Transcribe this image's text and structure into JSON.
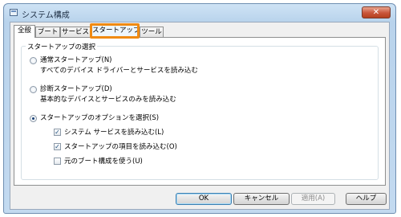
{
  "window": {
    "title": "システム構成",
    "close_label": "✕"
  },
  "tabs": [
    {
      "label": "全般"
    },
    {
      "label": "ブート"
    },
    {
      "label": "サービス"
    },
    {
      "label": "スタートアップ"
    },
    {
      "label": "ツール"
    }
  ],
  "startup_selection": {
    "legend": "スタートアップの選択",
    "normal": {
      "label": "通常スタートアップ(N)",
      "description": "すべてのデバイス ドライバーとサービスを読み込む"
    },
    "diagnostic": {
      "label": "診断スタートアップ(D)",
      "description": "基本的なデバイスとサービスのみを読み込む"
    },
    "selective": {
      "label": "スタートアップのオプションを選択(S)",
      "options": [
        {
          "label": "システム サービスを読み込む(L)",
          "mark": "✓"
        },
        {
          "label": "スタートアップの項目を読み込む(O)",
          "mark": "✓"
        },
        {
          "label": "元のブート構成を使う(U)",
          "mark": ""
        }
      ]
    }
  },
  "buttons": {
    "ok": "OK",
    "cancel": "キャンセル",
    "apply": "適用(A)",
    "help": "ヘルプ"
  },
  "colors": {
    "highlight": "#f08a12",
    "close": "#c9553a"
  }
}
